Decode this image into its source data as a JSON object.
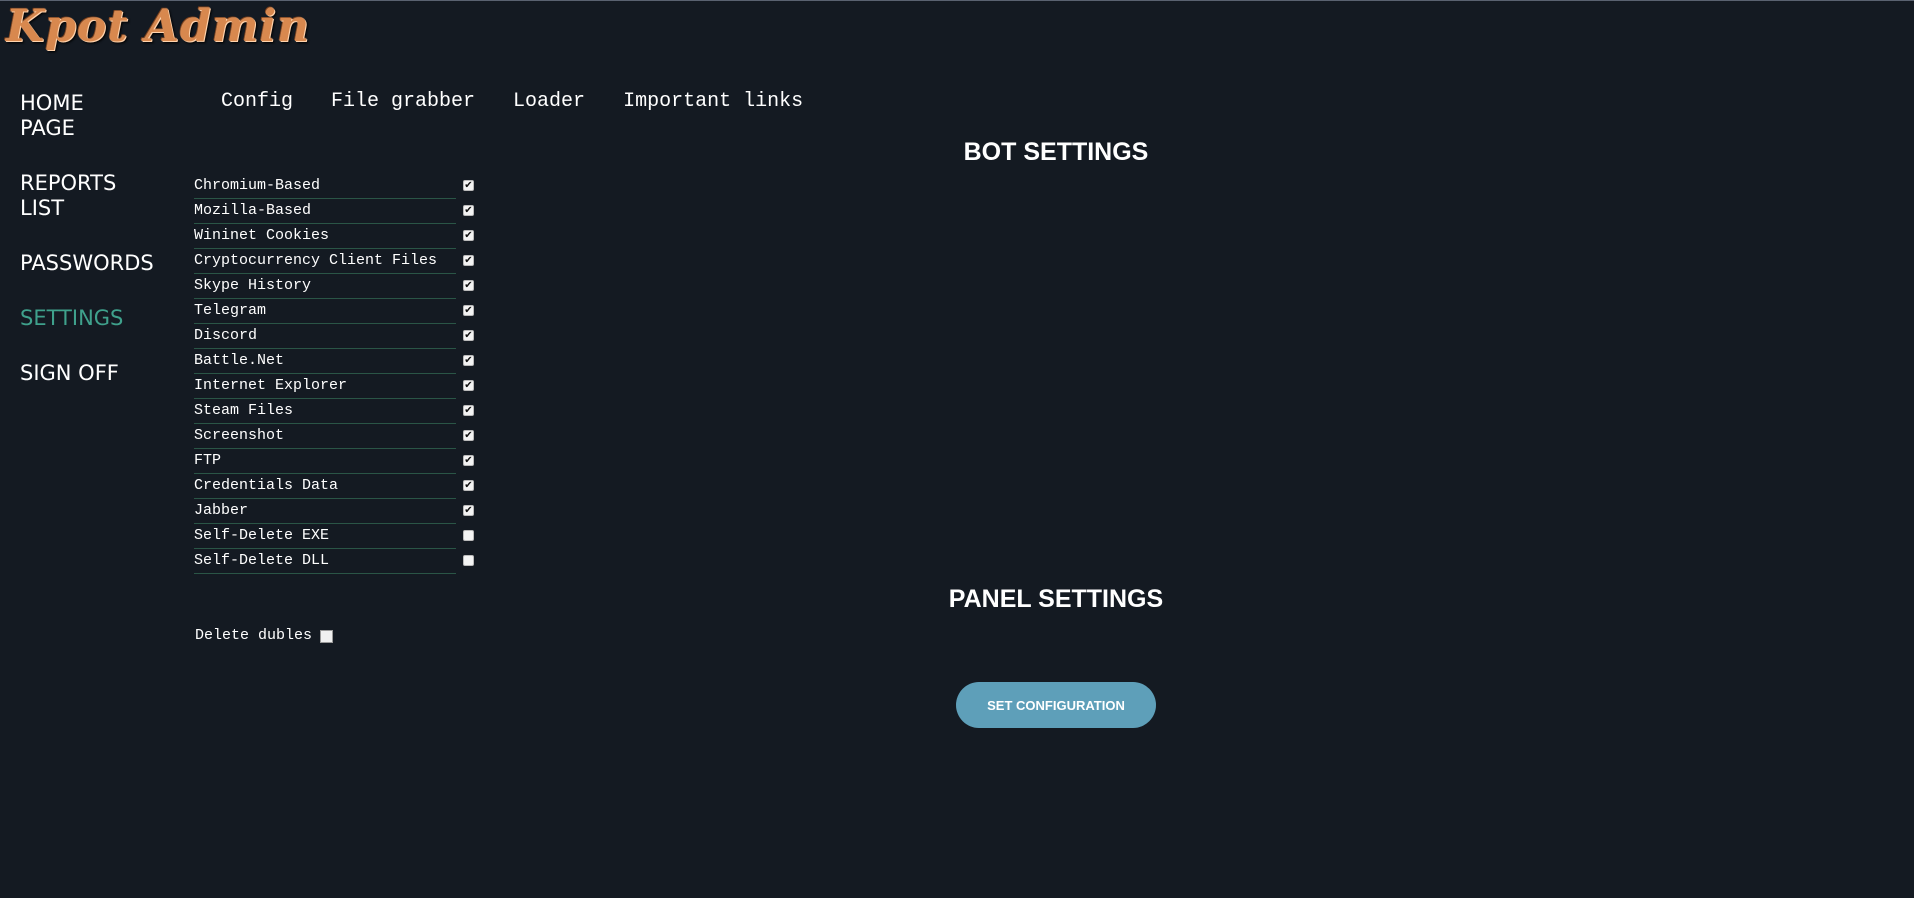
{
  "app": {
    "logo_text": "Kpot Admin"
  },
  "sidebar": {
    "items": [
      {
        "label": "HOME PAGE",
        "active": false
      },
      {
        "label": "REPORTS LIST",
        "active": false
      },
      {
        "label": "PASSWORDS",
        "active": false
      },
      {
        "label": "SETTINGS",
        "active": true
      },
      {
        "label": "SIGN OFF",
        "active": false
      }
    ]
  },
  "tabs": [
    {
      "label": "Config"
    },
    {
      "label": "File grabber"
    },
    {
      "label": "Loader"
    },
    {
      "label": "Important links"
    }
  ],
  "bot_settings": {
    "title": "BOT SETTINGS",
    "options": [
      {
        "label": "Chromium-Based",
        "checked": true
      },
      {
        "label": "Mozilla-Based",
        "checked": true
      },
      {
        "label": "Wininet Cookies",
        "checked": true
      },
      {
        "label": "Cryptocurrency Client Files",
        "checked": true
      },
      {
        "label": "Skype History",
        "checked": true
      },
      {
        "label": "Telegram",
        "checked": true
      },
      {
        "label": "Discord",
        "checked": true
      },
      {
        "label": "Battle.Net",
        "checked": true
      },
      {
        "label": "Internet Explorer",
        "checked": true
      },
      {
        "label": "Steam Files",
        "checked": true
      },
      {
        "label": "Screenshot",
        "checked": true
      },
      {
        "label": "FTP",
        "checked": true
      },
      {
        "label": "Credentials Data",
        "checked": true
      },
      {
        "label": "Jabber",
        "checked": true
      },
      {
        "label": "Self-Delete EXE",
        "checked": false
      },
      {
        "label": "Self-Delete DLL",
        "checked": false
      }
    ]
  },
  "panel_settings": {
    "title": "PANEL SETTINGS",
    "delete_dubles_label": "Delete dubles",
    "delete_dubles_checked": false
  },
  "actions": {
    "set_configuration_label": "SET CONFIGURATION"
  },
  "colors": {
    "background": "#141a22",
    "active_nav": "#3fa18c",
    "button": "#5e9fb9",
    "row_divider": "#2a5546",
    "logo": "#d8884e"
  }
}
